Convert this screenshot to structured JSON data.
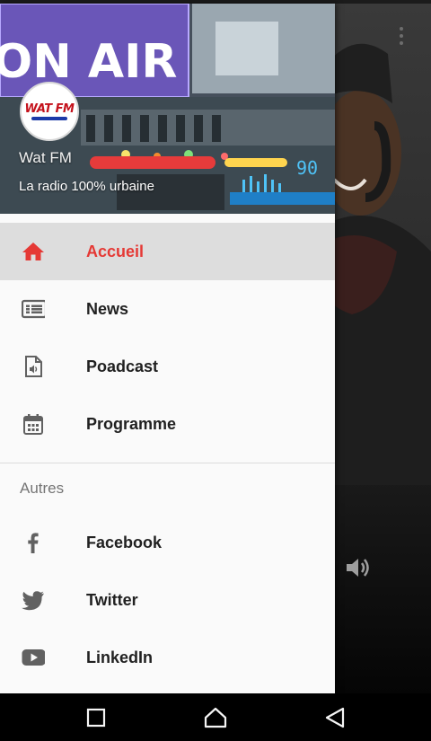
{
  "drawer": {
    "header": {
      "banner_text": "ON AIR",
      "logo_text": "WAT FM",
      "station_name": "Wat FM",
      "tagline": "La radio 100% urbaine",
      "frequency": "90"
    },
    "active_color": "#e53935",
    "items": [
      {
        "label": "Accueil",
        "icon": "home-icon",
        "active": true
      },
      {
        "label": "News",
        "icon": "news-icon",
        "active": false
      },
      {
        "label": "Poadcast",
        "icon": "audio-file-icon",
        "active": false
      },
      {
        "label": "Programme",
        "icon": "calendar-icon",
        "active": false
      }
    ],
    "section_title": "Autres",
    "social": [
      {
        "label": "Facebook",
        "icon": "facebook-icon"
      },
      {
        "label": "Twitter",
        "icon": "twitter-icon"
      },
      {
        "label": "LinkedIn",
        "icon": "youtube-icon"
      }
    ]
  },
  "background": {
    "icons": [
      "overflow-menu-icon",
      "volume-icon"
    ]
  },
  "nav_bar": {
    "buttons": [
      "recents-button",
      "home-button",
      "back-button"
    ]
  }
}
